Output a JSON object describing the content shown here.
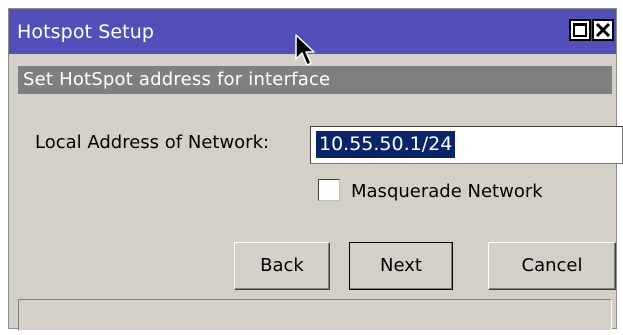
{
  "window": {
    "title": "Hotspot Setup",
    "controls": {
      "maximize": "maximize-icon",
      "close": "close-icon"
    }
  },
  "header": {
    "text": "Set HotSpot address for interface"
  },
  "form": {
    "address_label": "Local Address of Network:",
    "address_value": "10.55.50.1/24",
    "masquerade_label": "Masquerade Network",
    "masquerade_checked": false
  },
  "buttons": {
    "back": "Back",
    "next": "Next",
    "cancel": "Cancel"
  },
  "colors": {
    "titlebar": "#5050b8",
    "header": "#808080",
    "selection": "#0a246a",
    "face": "#d4d0c8"
  }
}
